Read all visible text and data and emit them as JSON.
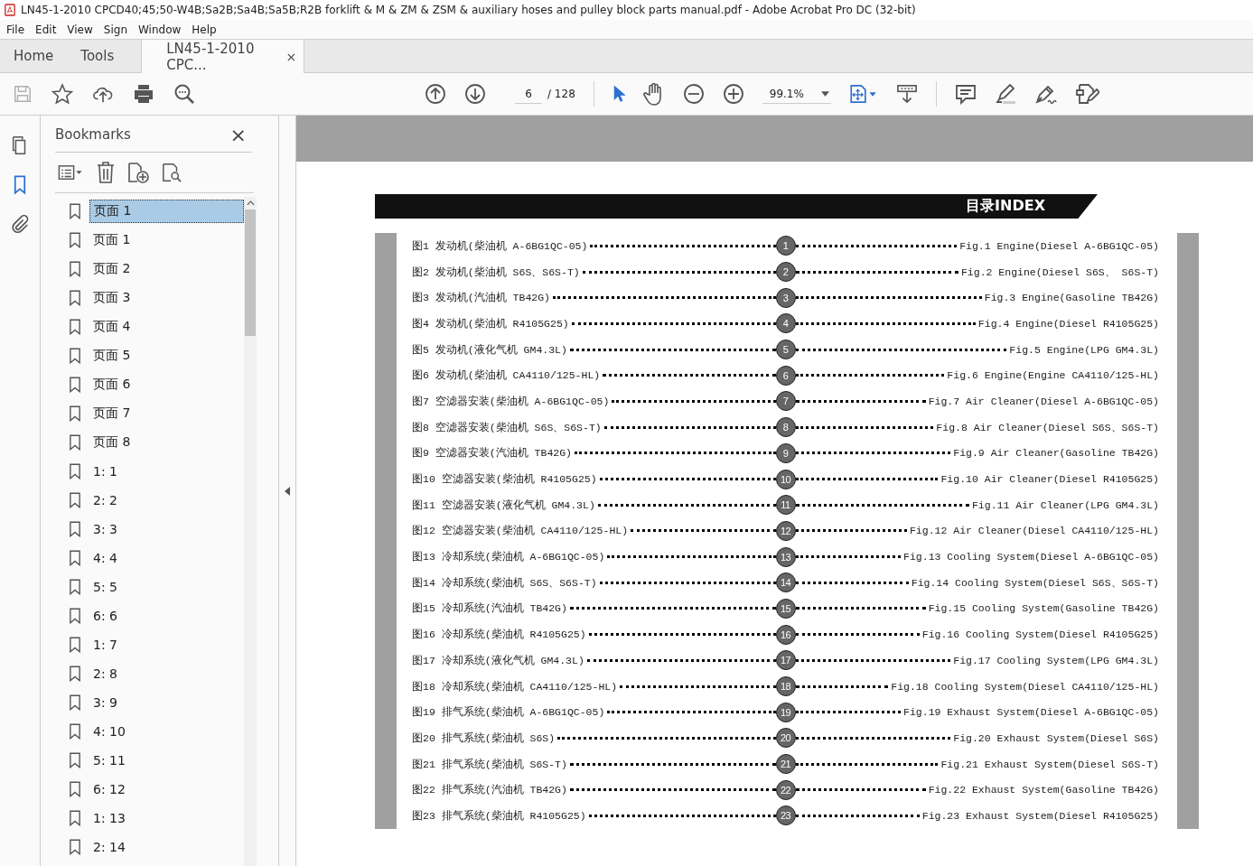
{
  "window": {
    "title": "LN45-1-2010 CPCD40;45;50-W4B;Sa2B;Sa4B;Sa5B;R2B forklift & M & ZM & ZSM & auxiliary hoses and pulley block parts manual.pdf - Adobe Acrobat Pro DC (32-bit)"
  },
  "menu": [
    "File",
    "Edit",
    "View",
    "Sign",
    "Window",
    "Help"
  ],
  "tabs": [
    {
      "label": "Home",
      "selected": false,
      "kind": "nav"
    },
    {
      "label": "Tools",
      "selected": false,
      "kind": "nav"
    },
    {
      "label": "LN45-1-2010 CPC...",
      "selected": true,
      "kind": "doc",
      "close": "×"
    }
  ],
  "toolbar": {
    "page": "6",
    "total": "/ 128",
    "zoom": "99.1%"
  },
  "bookmarks": {
    "title": "Bookmarks",
    "close": "×",
    "items": [
      {
        "label": "页面 1",
        "selected": true
      },
      {
        "label": "页面 1",
        "selected": false
      },
      {
        "label": "页面 2",
        "selected": false
      },
      {
        "label": "页面 3",
        "selected": false
      },
      {
        "label": "页面 4",
        "selected": false
      },
      {
        "label": "页面 5",
        "selected": false
      },
      {
        "label": "页面 6",
        "selected": false
      },
      {
        "label": "页面 7",
        "selected": false
      },
      {
        "label": "页面 8",
        "selected": false
      },
      {
        "label": "1: 1",
        "selected": false
      },
      {
        "label": "2: 2",
        "selected": false
      },
      {
        "label": "3: 3",
        "selected": false
      },
      {
        "label": "4: 4",
        "selected": false
      },
      {
        "label": "5: 5",
        "selected": false
      },
      {
        "label": "6: 6",
        "selected": false
      },
      {
        "label": "1: 7",
        "selected": false
      },
      {
        "label": "2: 8",
        "selected": false
      },
      {
        "label": "3: 9",
        "selected": false
      },
      {
        "label": "4: 10",
        "selected": false
      },
      {
        "label": "5: 11",
        "selected": false
      },
      {
        "label": "6: 12",
        "selected": false
      },
      {
        "label": "1: 13",
        "selected": false
      },
      {
        "label": "2: 14",
        "selected": false
      }
    ]
  },
  "document": {
    "heading": "目录INDEX",
    "entries": [
      {
        "cn": "图1 发动机(柴油机 A-6BG1QC-05)",
        "num": "1",
        "en": "Fig.1 Engine(Diesel A-6BG1QC-05)"
      },
      {
        "cn": "图2 发动机(柴油机 S6S、S6S-T)",
        "num": "2",
        "en": "Fig.2 Engine(Diesel S6S、 S6S-T)"
      },
      {
        "cn": "图3 发动机(汽油机 TB42G)",
        "num": "3",
        "en": "Fig.3 Engine(Gasoline TB42G)"
      },
      {
        "cn": "图4 发动机(柴油机 R4105G25)",
        "num": "4",
        "en": "Fig.4 Engine(Diesel R4105G25)"
      },
      {
        "cn": "图5 发动机(液化气机 GM4.3L)",
        "num": "5",
        "en": "Fig.5 Engine(LPG GM4.3L)"
      },
      {
        "cn": "图6 发动机(柴油机 CA4110/125-HL)",
        "num": "6",
        "en": "Fig.6 Engine(Engine CA4110/125-HL)"
      },
      {
        "cn": "图7 空滤器安装(柴油机 A-6BG1QC-05)",
        "num": "7",
        "en": "Fig.7 Air Cleaner(Diesel A-6BG1QC-05)"
      },
      {
        "cn": "图8 空滤器安装(柴油机 S6S、S6S-T)",
        "num": "8",
        "en": "Fig.8 Air Cleaner(Diesel S6S、S6S-T)"
      },
      {
        "cn": "图9 空滤器安装(汽油机 TB42G)",
        "num": "9",
        "en": "Fig.9 Air Cleaner(Gasoline TB42G)"
      },
      {
        "cn": "图10 空滤器安装(柴油机 R4105G25)",
        "num": "10",
        "en": "Fig.10 Air Cleaner(Diesel R4105G25)"
      },
      {
        "cn": "图11 空滤器安装(液化气机 GM4.3L)",
        "num": "11",
        "en": "Fig.11 Air Cleaner(LPG GM4.3L)"
      },
      {
        "cn": "图12 空滤器安装(柴油机 CA4110/125-HL)",
        "num": "12",
        "en": "Fig.12 Air Cleaner(Diesel CA4110/125-HL)"
      },
      {
        "cn": "图13 冷却系统(柴油机 A-6BG1QC-05)",
        "num": "13",
        "en": "Fig.13 Cooling System(Diesel A-6BG1QC-05)"
      },
      {
        "cn": "图14 冷却系统(柴油机 S6S、S6S-T)",
        "num": "14",
        "en": "Fig.14 Cooling System(Diesel S6S、S6S-T)"
      },
      {
        "cn": "图15 冷却系统(汽油机 TB42G)",
        "num": "15",
        "en": "Fig.15 Cooling System(Gasoline TB42G)"
      },
      {
        "cn": "图16 冷却系统(柴油机 R4105G25)",
        "num": "16",
        "en": "Fig.16 Cooling System(Diesel R4105G25)"
      },
      {
        "cn": "图17 冷却系统(液化气机 GM4.3L)",
        "num": "17",
        "en": "Fig.17 Cooling System(LPG GM4.3L)"
      },
      {
        "cn": "图18 冷却系统(柴油机 CA4110/125-HL)",
        "num": "18",
        "en": "Fig.18 Cooling System(Diesel CA4110/125-HL)"
      },
      {
        "cn": "图19 排气系统(柴油机 A-6BG1QC-05)",
        "num": "19",
        "en": "Fig.19 Exhaust System(Diesel A-6BG1QC-05)"
      },
      {
        "cn": "图20 排气系统(柴油机 S6S)",
        "num": "20",
        "en": "Fig.20 Exhaust System(Diesel S6S)"
      },
      {
        "cn": "图21 排气系统(柴油机 S6S-T)",
        "num": "21",
        "en": "Fig.21 Exhaust System(Diesel S6S-T)"
      },
      {
        "cn": "图22 排气系统(汽油机 TB42G)",
        "num": "22",
        "en": "Fig.22 Exhaust System(Gasoline TB42G)"
      },
      {
        "cn": "图23 排气系统(柴油机 R4105G25)",
        "num": "23",
        "en": "Fig.23 Exhaust System(Diesel R4105G25)"
      }
    ]
  }
}
